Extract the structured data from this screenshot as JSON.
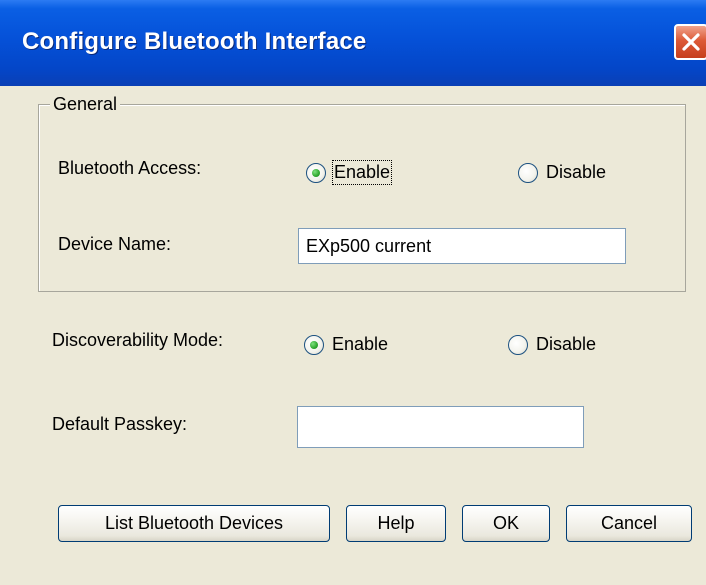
{
  "window": {
    "title": "Configure Bluetooth Interface",
    "close_icon": "close-icon"
  },
  "general": {
    "group_label": "General",
    "bluetooth_access": {
      "label": "Bluetooth Access:",
      "enable_label": "Enable",
      "disable_label": "Disable",
      "selected": "Enable"
    },
    "device_name": {
      "label": "Device Name:",
      "value": "EXp500 current"
    }
  },
  "discoverability": {
    "label": "Discoverability Mode:",
    "enable_label": "Enable",
    "disable_label": "Disable",
    "selected": "Enable"
  },
  "passkey": {
    "label": "Default Passkey:",
    "value": ""
  },
  "buttons": {
    "list_devices": "List Bluetooth Devices",
    "help": "Help",
    "ok": "OK",
    "cancel": "Cancel"
  }
}
